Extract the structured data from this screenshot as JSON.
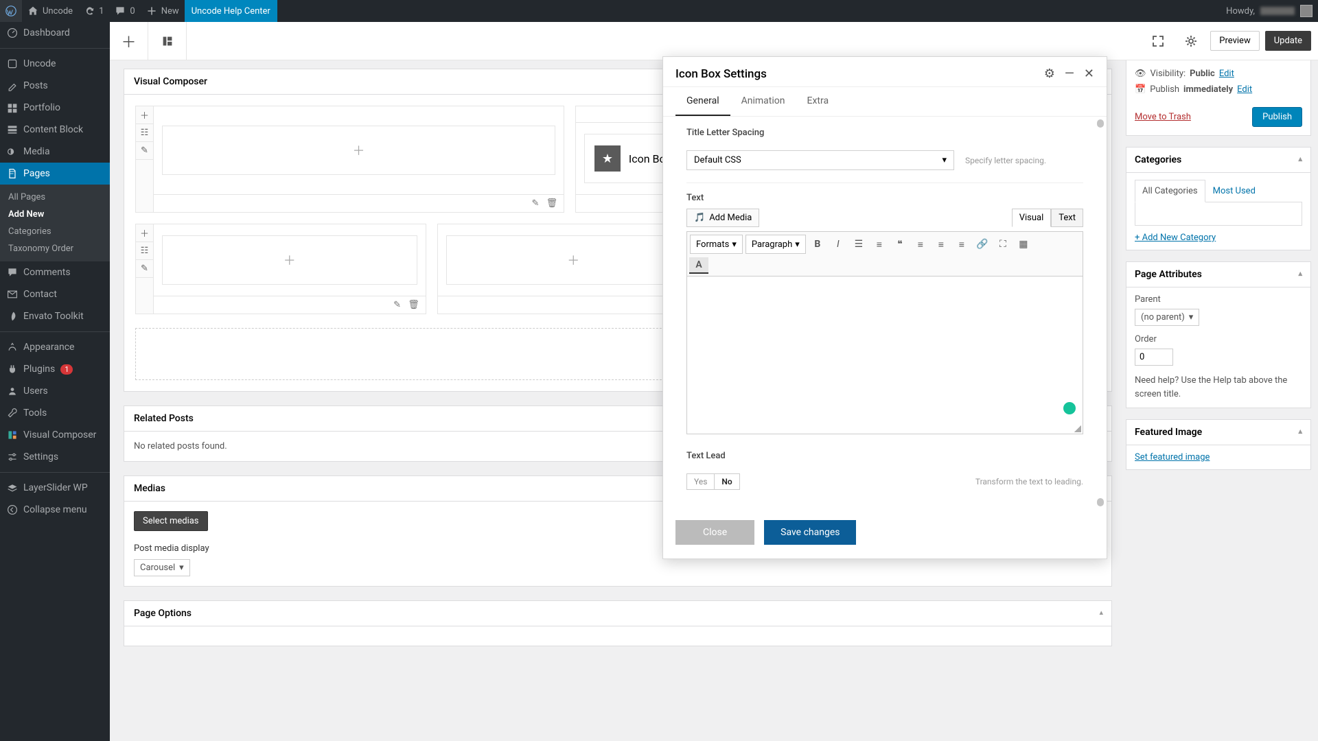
{
  "adminbar": {
    "site": "Uncode",
    "updates": "1",
    "comments": "0",
    "new": "New",
    "helpcenter": "Uncode Help Center",
    "howdy": "Howdy,"
  },
  "sidebar": {
    "dashboard": "Dashboard",
    "uncode": "Uncode",
    "posts": "Posts",
    "portfolio": "Portfolio",
    "contentblock": "Content Block",
    "media": "Media",
    "pages": "Pages",
    "pages_sub": {
      "all": "All Pages",
      "add": "Add New",
      "categories": "Categories",
      "tax": "Taxonomy Order"
    },
    "comments": "Comments",
    "contact": "Contact",
    "envato": "Envato Toolkit",
    "appearance": "Appearance",
    "plugins": "Plugins",
    "plugins_badge": "1",
    "users": "Users",
    "tools": "Tools",
    "visual": "Visual Composer",
    "settings": "Settings",
    "layerslider": "LayerSlider WP",
    "collapse": "Collapse menu"
  },
  "toolbar": {
    "preview": "Preview",
    "update": "Update"
  },
  "vc": {
    "panel_title": "Visual Composer",
    "iconbox": "Icon Box"
  },
  "related": {
    "title": "Related Posts",
    "none": "No related posts found."
  },
  "medias": {
    "title": "Medias",
    "select": "Select medias",
    "display_label": "Post media display",
    "carousel": "Carousel"
  },
  "pageoptions": {
    "title": "Page Options"
  },
  "modal": {
    "title": "Icon Box Settings",
    "tabs": {
      "general": "General",
      "animation": "Animation",
      "extra": "Extra"
    },
    "letter_label": "Title Letter Spacing",
    "letter_value": "Default CSS",
    "letter_hint": "Specify letter spacing.",
    "text_label": "Text",
    "add_media": "Add Media",
    "ed_visual": "Visual",
    "ed_text": "Text",
    "formats": "Formats",
    "paragraph": "Paragraph",
    "textlead_label": "Text Lead",
    "textlead_hint": "Transform the text to leading.",
    "yes": "Yes",
    "no": "No",
    "close": "Close",
    "save": "Save changes"
  },
  "meta": {
    "visibility_label": "Visibility:",
    "visibility_value": "Public",
    "publish_label": "Publish",
    "publish_value": "immediately",
    "edit": "Edit",
    "trash": "Move to Trash",
    "publish_btn": "Publish",
    "categories": {
      "title": "Categories",
      "tab_all": "All Categories",
      "tab_most": "Most Used",
      "addnew": "+ Add New Category"
    },
    "attributes": {
      "title": "Page Attributes",
      "parent": "Parent",
      "parent_val": "(no parent)",
      "order": "Order",
      "order_val": "0",
      "help": "Need help? Use the Help tab above the screen title."
    },
    "featured": {
      "title": "Featured Image",
      "set": "Set featured image"
    }
  }
}
